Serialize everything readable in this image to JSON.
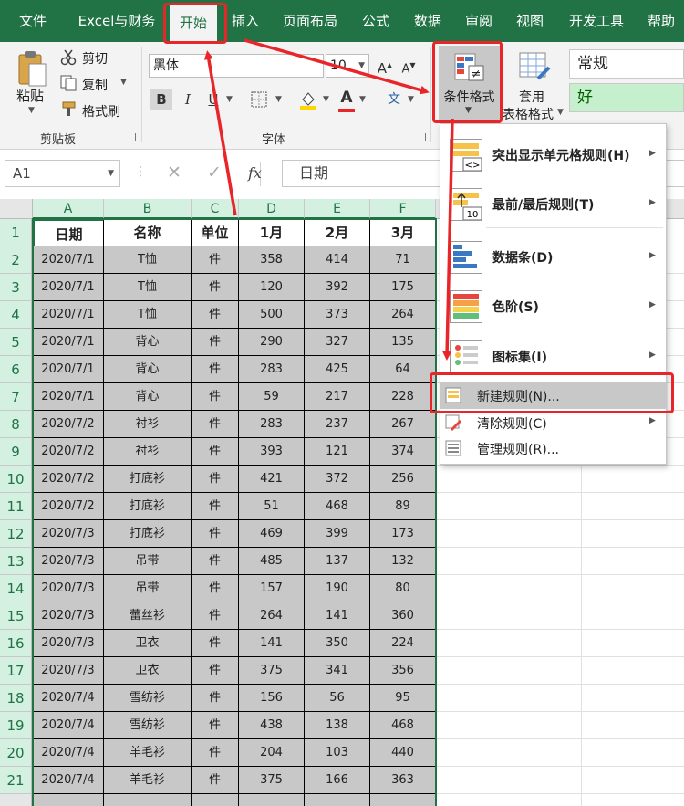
{
  "tabs": [
    "文件",
    "Excel与财务",
    "开始",
    "插入",
    "页面布局",
    "公式",
    "数据",
    "审阅",
    "视图",
    "开发工具",
    "帮助"
  ],
  "clipboard": {
    "paste": "粘贴",
    "cut": "剪切",
    "copy": "复制",
    "format_painter": "格式刷",
    "group": "剪贴板"
  },
  "font": {
    "name": "黑体",
    "size": "10",
    "grow": "A",
    "shrink": "A",
    "bold": "B",
    "italic": "I",
    "underline": "U",
    "fill_color": "A",
    "wen": "文",
    "group": "字体"
  },
  "styles": {
    "cond_format": "条件格式",
    "table_format_1": "套用",
    "table_format_2": "表格格式",
    "style_normal": "常规",
    "style_good": "好"
  },
  "formula_bar": {
    "name_box": "A1",
    "fx": "fx",
    "content": "日期"
  },
  "columns": [
    "A",
    "B",
    "C",
    "D",
    "E",
    "F"
  ],
  "table": {
    "headers": [
      "日期",
      "名称",
      "单位",
      "1月",
      "2月",
      "3月"
    ],
    "rows": [
      [
        "2020/7/1",
        "T恤",
        "件",
        "358",
        "414",
        "71"
      ],
      [
        "2020/7/1",
        "T恤",
        "件",
        "120",
        "392",
        "175"
      ],
      [
        "2020/7/1",
        "T恤",
        "件",
        "500",
        "373",
        "264"
      ],
      [
        "2020/7/1",
        "背心",
        "件",
        "290",
        "327",
        "135"
      ],
      [
        "2020/7/1",
        "背心",
        "件",
        "283",
        "425",
        "64"
      ],
      [
        "2020/7/1",
        "背心",
        "件",
        "59",
        "217",
        "228"
      ],
      [
        "2020/7/2",
        "衬衫",
        "件",
        "283",
        "237",
        "267"
      ],
      [
        "2020/7/2",
        "衬衫",
        "件",
        "393",
        "121",
        "374"
      ],
      [
        "2020/7/2",
        "打底衫",
        "件",
        "421",
        "372",
        "256"
      ],
      [
        "2020/7/2",
        "打底衫",
        "件",
        "51",
        "468",
        "89"
      ],
      [
        "2020/7/3",
        "打底衫",
        "件",
        "469",
        "399",
        "173"
      ],
      [
        "2020/7/3",
        "吊带",
        "件",
        "485",
        "137",
        "132"
      ],
      [
        "2020/7/3",
        "吊带",
        "件",
        "157",
        "190",
        "80"
      ],
      [
        "2020/7/3",
        "蕾丝衫",
        "件",
        "264",
        "141",
        "360"
      ],
      [
        "2020/7/3",
        "卫衣",
        "件",
        "141",
        "350",
        "224"
      ],
      [
        "2020/7/3",
        "卫衣",
        "件",
        "375",
        "341",
        "356"
      ],
      [
        "2020/7/4",
        "雪纺衫",
        "件",
        "156",
        "56",
        "95"
      ],
      [
        "2020/7/4",
        "雪纺衫",
        "件",
        "438",
        "138",
        "468"
      ],
      [
        "2020/7/4",
        "羊毛衫",
        "件",
        "204",
        "103",
        "440"
      ],
      [
        "2020/7/4",
        "羊毛衫",
        "件",
        "375",
        "166",
        "363"
      ]
    ]
  },
  "row_numbers": [
    "1",
    "2",
    "3",
    "4",
    "5",
    "6",
    "7",
    "8",
    "9",
    "10",
    "11",
    "12",
    "13",
    "14",
    "15",
    "16",
    "17",
    "18",
    "19",
    "20",
    "21"
  ],
  "cf_menu": {
    "highlight": "突出显示单元格规则(H)",
    "topbottom": "最前/最后规则(T)",
    "databars": "数据条(D)",
    "colorscales": "色阶(S)",
    "iconsets": "图标集(I)",
    "new_rule": "新建规则(N)...",
    "clear_rules": "清除规则(C)",
    "manage_rules": "管理规则(R)..."
  },
  "colors": {
    "accent": "#217346",
    "annotation": "#e8262a",
    "selection": "#c8c8c8"
  }
}
